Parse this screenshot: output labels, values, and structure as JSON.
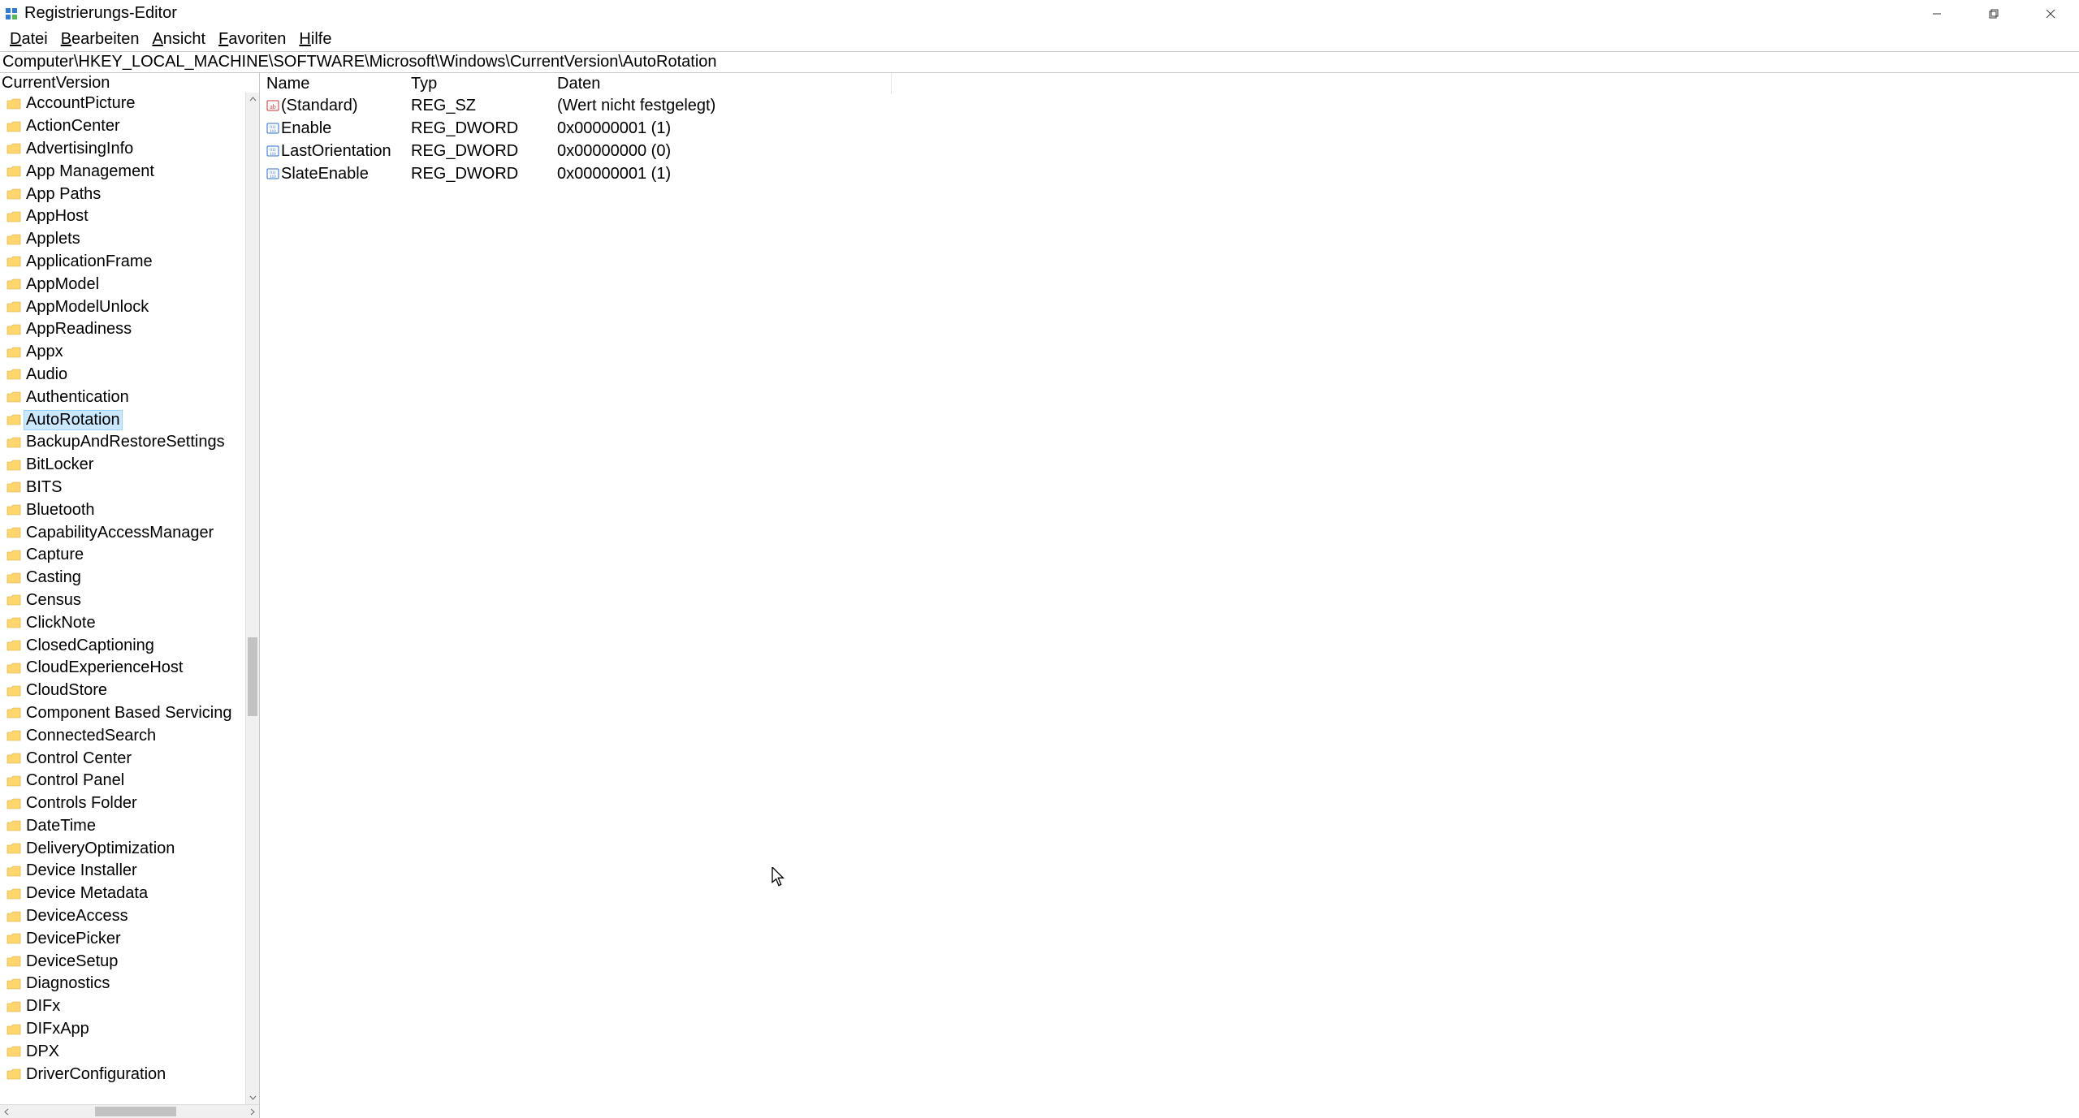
{
  "window": {
    "title": "Registrierungs-Editor"
  },
  "menus": {
    "file": {
      "label": "Datei",
      "accel_index": 0
    },
    "edit": {
      "label": "Bearbeiten",
      "accel_index": 0
    },
    "view": {
      "label": "Ansicht",
      "accel_index": 0
    },
    "fav": {
      "label": "Favoriten",
      "accel_index": 0
    },
    "help": {
      "label": "Hilfe",
      "accel_index": 0
    }
  },
  "addressbar": {
    "value": "Computer\\HKEY_LOCAL_MACHINE\\SOFTWARE\\Microsoft\\Windows\\CurrentVersion\\AutoRotation"
  },
  "tree": {
    "header": "CurrentVersion",
    "selected_key": "AutoRotation",
    "items": [
      "AccountPicture",
      "ActionCenter",
      "AdvertisingInfo",
      "App Management",
      "App Paths",
      "AppHost",
      "Applets",
      "ApplicationFrame",
      "AppModel",
      "AppModelUnlock",
      "AppReadiness",
      "Appx",
      "Audio",
      "Authentication",
      "AutoRotation",
      "BackupAndRestoreSettings",
      "BitLocker",
      "BITS",
      "Bluetooth",
      "CapabilityAccessManager",
      "Capture",
      "Casting",
      "Census",
      "ClickNote",
      "ClosedCaptioning",
      "CloudExperienceHost",
      "CloudStore",
      "Component Based Servicing",
      "ConnectedSearch",
      "Control Center",
      "Control Panel",
      "Controls Folder",
      "DateTime",
      "DeliveryOptimization",
      "Device Installer",
      "Device Metadata",
      "DeviceAccess",
      "DevicePicker",
      "DeviceSetup",
      "Diagnostics",
      "DIFx",
      "DIFxApp",
      "DPX",
      "DriverConfiguration"
    ]
  },
  "list": {
    "columns": {
      "name": "Name",
      "type": "Typ",
      "data": "Daten"
    },
    "rows": [
      {
        "icon": "sz",
        "name": "(Standard)",
        "type": "REG_SZ",
        "data": "(Wert nicht festgelegt)"
      },
      {
        "icon": "dword",
        "name": "Enable",
        "type": "REG_DWORD",
        "data": "0x00000001 (1)"
      },
      {
        "icon": "dword",
        "name": "LastOrientation",
        "type": "REG_DWORD",
        "data": "0x00000000 (0)"
      },
      {
        "icon": "dword",
        "name": "SlateEnable",
        "type": "REG_DWORD",
        "data": "0x00000001 (1)"
      }
    ]
  }
}
